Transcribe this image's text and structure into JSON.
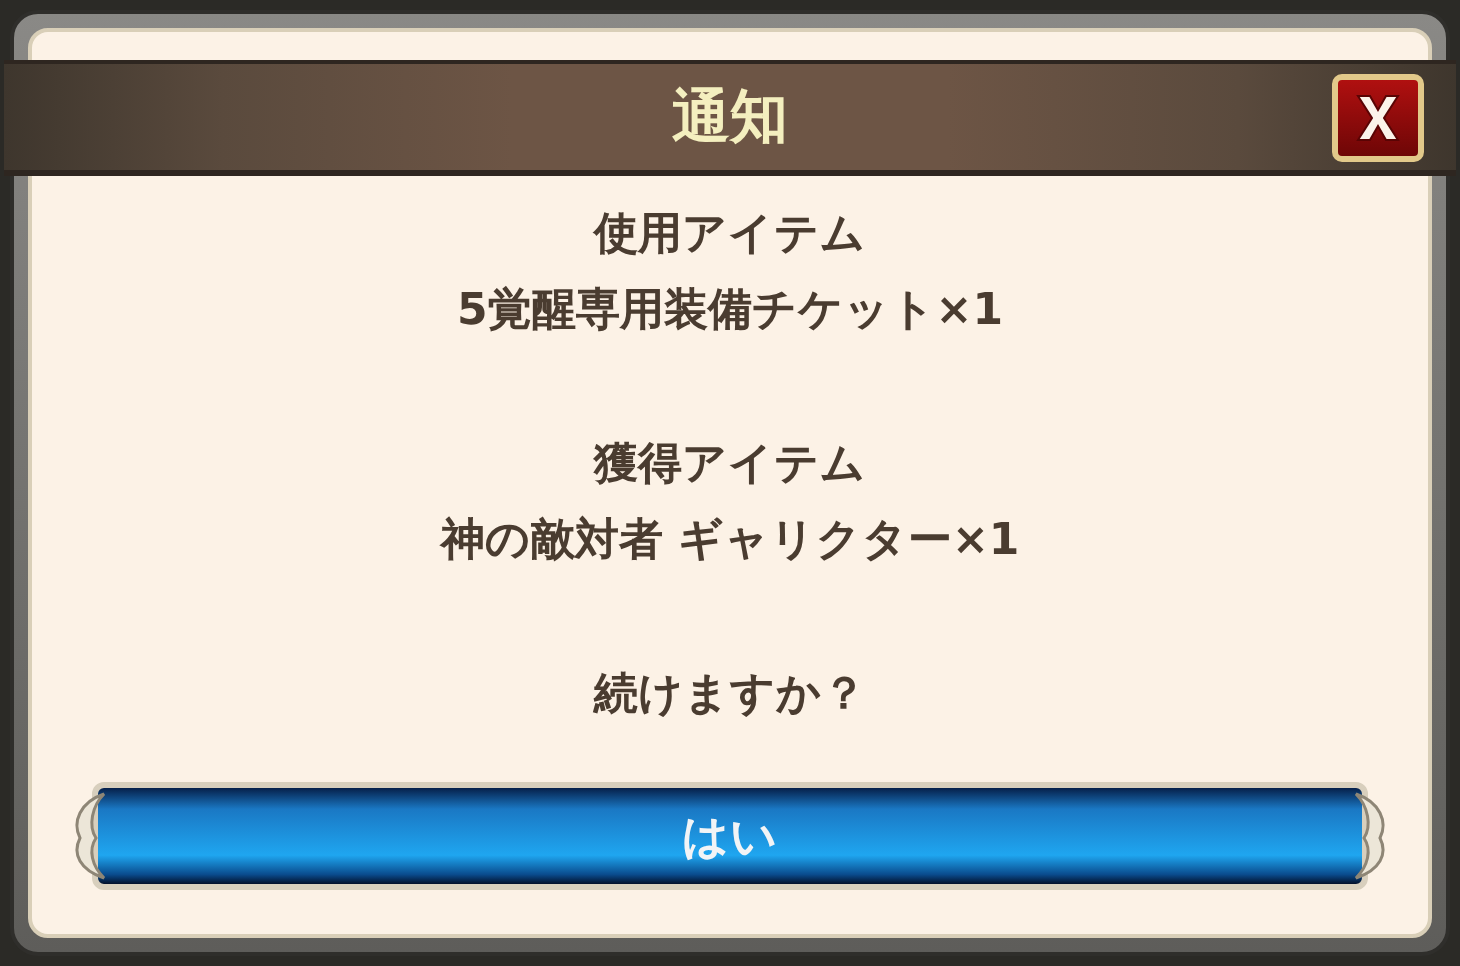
{
  "dialog": {
    "title": "通知",
    "sections": [
      {
        "heading": "使用アイテム",
        "item": "5覚醒専用装備チケット×1"
      },
      {
        "heading": "獲得アイテム",
        "item": "神の敵対者 ギャリクター×1"
      }
    ],
    "question": "続けますか？",
    "confirm_button": "はい"
  }
}
